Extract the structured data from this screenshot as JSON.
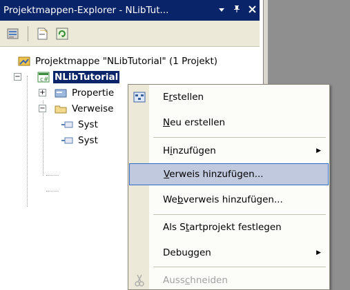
{
  "window": {
    "title": "Projektmappen-Explorer - NLibTut...",
    "pin_glyph": "▾",
    "dock_glyph": "ᵖ",
    "close_glyph": "✕"
  },
  "toolbar": {
    "icons": [
      "properties-icon",
      "show-all-files-icon",
      "refresh-icon"
    ]
  },
  "tree": {
    "solution_label": "Projektmappe \"NLibTutorial\" (1 Projekt)",
    "project_label": "NLibTutorial",
    "properties_label": "Propertie",
    "references_label": "Verweise",
    "ref1_label": "Syst",
    "ref2_label": "Syst"
  },
  "context_menu": {
    "items": [
      {
        "pre": "E",
        "u": "r",
        "post": "stellen"
      },
      {
        "pre": "",
        "u": "N",
        "post": "eu erstellen"
      },
      {
        "pre": "H",
        "u": "i",
        "post": "nzufügen"
      },
      {
        "pre": "",
        "u": "V",
        "post": "erweis hinzufügen..."
      },
      {
        "pre": "We",
        "u": "b",
        "post": "verweis hinzufügen..."
      },
      {
        "pre": "Als S",
        "u": "t",
        "post": "artprojekt festlegen"
      },
      {
        "pre": "Debu",
        "u": "g",
        "post": "gen"
      },
      {
        "pre": "Auss",
        "u": "c",
        "post": "hneiden"
      }
    ],
    "submenu_arrow": "▶",
    "colors": {
      "hover_bg": "#c1c9df",
      "hover_border": "#316ac5",
      "gutter": "#ece9d8"
    }
  },
  "colors": {
    "title_bg": "#0a246a",
    "selection_bg": "#0a246a",
    "toolbar_bg": "#ece9d8"
  }
}
